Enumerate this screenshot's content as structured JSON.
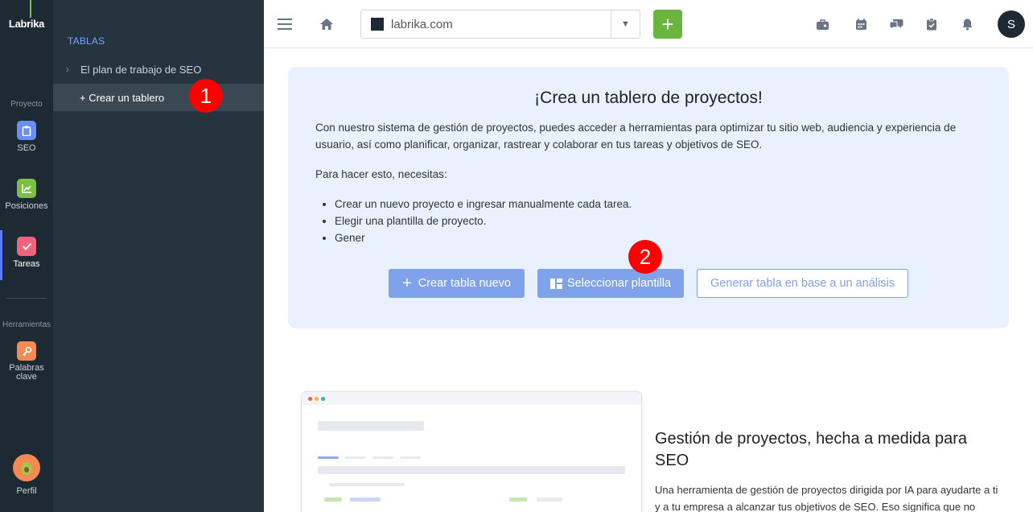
{
  "rail": {
    "logo": "Labrika",
    "section_project": "Proyecto",
    "section_tools": "Herramientas",
    "items": [
      {
        "label": "SEO",
        "icon": "clipboard-icon",
        "color": "#6b8ef0"
      },
      {
        "label": "Posiciones",
        "icon": "chart-icon",
        "color": "#7bc043"
      },
      {
        "label": "Tareas",
        "icon": "check-icon",
        "color": "#f0637a"
      },
      {
        "label": "Palabras clave",
        "icon": "key-icon",
        "color": "#f28a54"
      },
      {
        "label": "Perfil",
        "icon": "avocado-icon",
        "color": "#f28a54"
      }
    ]
  },
  "sidebar": {
    "heading": "TABLAS",
    "items": [
      {
        "label": "El plan de trabajo de SEO"
      },
      {
        "label": "+ Crear un tablero"
      }
    ]
  },
  "markers": {
    "one": "1",
    "two": "2"
  },
  "topbar": {
    "site": "labrika.com",
    "add_label": "+",
    "user_initial": "S"
  },
  "card": {
    "title": "¡Crea un tablero de proyectos!",
    "intro": "Con nuestro sistema de gestión de proyectos, puedes acceder a herramientas para optimizar tu sitio web, audiencia y experiencia de usuario, así como planificar, organizar, rastrear y colaborar en tus tareas y objetivos de SEO.",
    "need": "Para hacer esto, necesitas:",
    "list": [
      "Crear un nuevo proyecto e ingresar manualmente cada tarea.",
      "Elegir una plantilla de proyecto.",
      "Gener"
    ],
    "buttons": {
      "create": "Crear tabla nuevo",
      "template": "Seleccionar plantilla",
      "generate": "Generar tabla en base a un análisis"
    }
  },
  "feature": {
    "title": "Gestión de proyectos, hecha a medida para SEO",
    "text": "Una herramienta de gestión de proyectos dirigida por IA para ayudarte a ti y a tu empresa a alcanzar tus objetivos de SEO. Eso significa que no"
  }
}
